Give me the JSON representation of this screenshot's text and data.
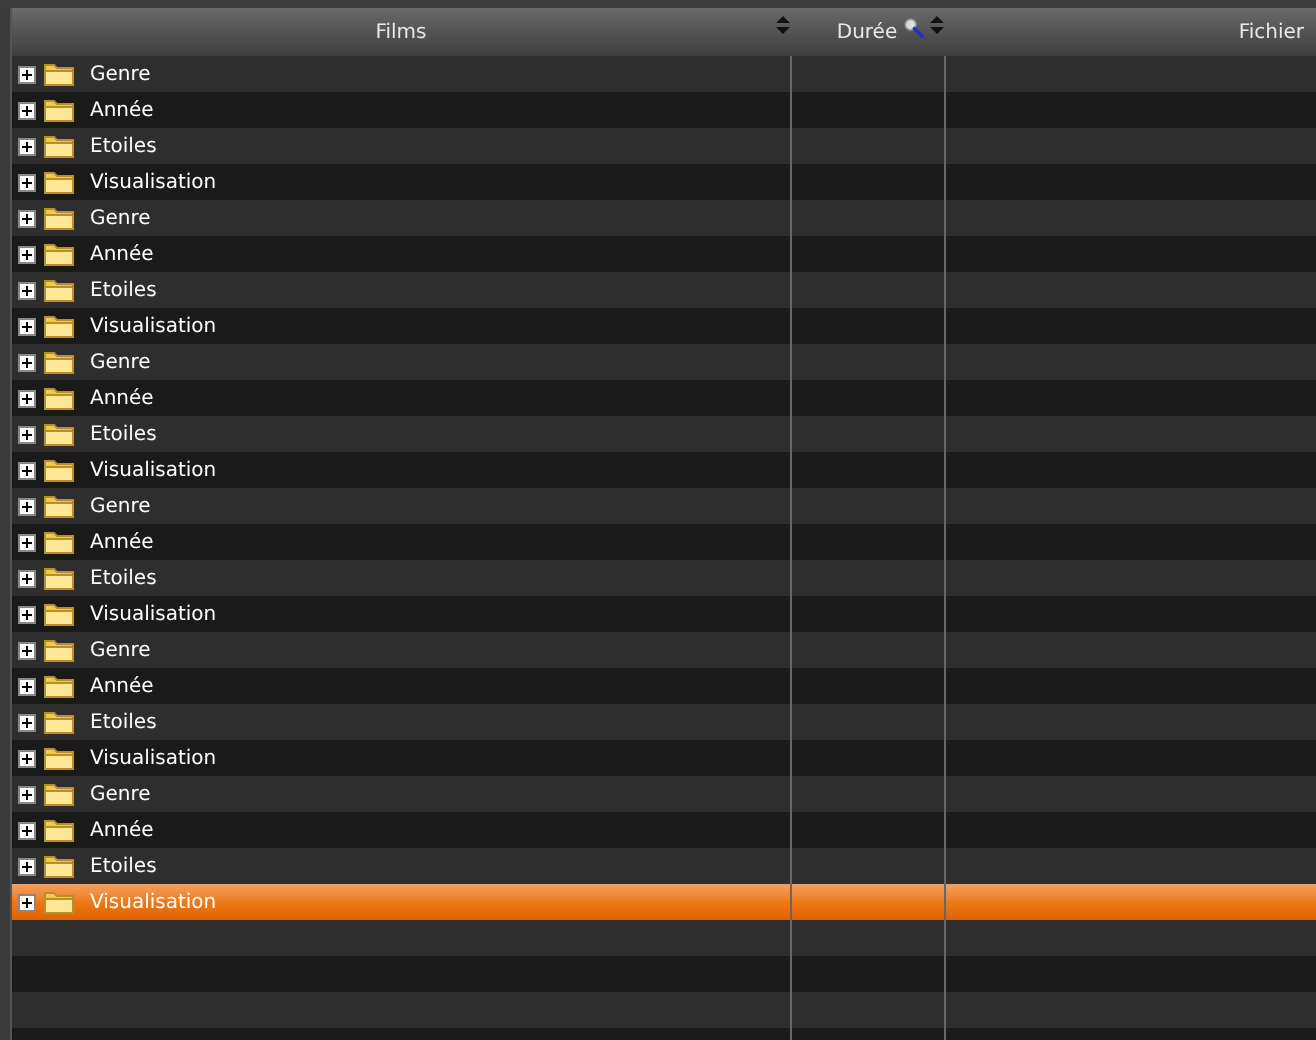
{
  "table": {
    "columns": [
      {
        "label": "Films",
        "sortable": true
      },
      {
        "label": "Durée",
        "sortable": true,
        "search": true
      },
      {
        "label": "Fichier",
        "sortable": false
      }
    ],
    "rows": [
      {
        "label": "Genre",
        "selected": false
      },
      {
        "label": "Année",
        "selected": false
      },
      {
        "label": "Etoiles",
        "selected": false
      },
      {
        "label": "Visualisation",
        "selected": false
      },
      {
        "label": "Genre",
        "selected": false
      },
      {
        "label": "Année",
        "selected": false
      },
      {
        "label": "Etoiles",
        "selected": false
      },
      {
        "label": "Visualisation",
        "selected": false
      },
      {
        "label": "Genre",
        "selected": false
      },
      {
        "label": "Année",
        "selected": false
      },
      {
        "label": "Etoiles",
        "selected": false
      },
      {
        "label": "Visualisation",
        "selected": false
      },
      {
        "label": "Genre",
        "selected": false
      },
      {
        "label": "Année",
        "selected": false
      },
      {
        "label": "Etoiles",
        "selected": false
      },
      {
        "label": "Visualisation",
        "selected": false
      },
      {
        "label": "Genre",
        "selected": false
      },
      {
        "label": "Année",
        "selected": false
      },
      {
        "label": "Etoiles",
        "selected": false
      },
      {
        "label": "Visualisation",
        "selected": false
      },
      {
        "label": "Genre",
        "selected": false
      },
      {
        "label": "Année",
        "selected": false
      },
      {
        "label": "Etoiles",
        "selected": false
      },
      {
        "label": "Visualisation",
        "selected": true
      }
    ]
  }
}
